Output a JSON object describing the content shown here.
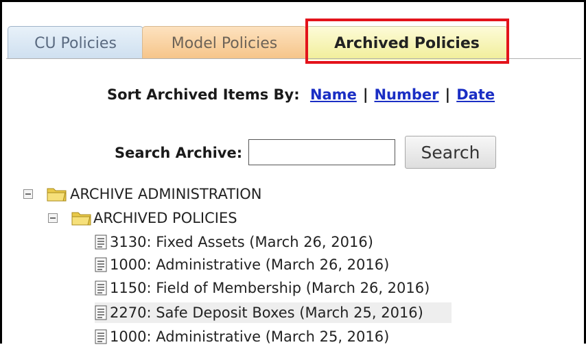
{
  "tabs": [
    {
      "label": "CU Policies"
    },
    {
      "label": "Model Policies"
    },
    {
      "label": "Archived Policies"
    }
  ],
  "sort": {
    "prefix": "Sort Archived Items By:",
    "links": [
      "Name",
      "Number",
      "Date"
    ],
    "separator": "|"
  },
  "search": {
    "label": "Search Archive:",
    "value": "",
    "button_label": "Search"
  },
  "tree": {
    "root": "ARCHIVE ADMINISTRATION",
    "folder": "ARCHIVED POLICIES",
    "items": [
      "3130: Fixed Assets (March 26, 2016)",
      "1000: Administrative (March 26, 2016)",
      "1150: Field of Membership (March 26, 2016)",
      "2270: Safe Deposit Boxes (March 25, 2016)",
      "1000: Administrative (March 25, 2016)"
    ]
  },
  "colors": {
    "highlight": "#e3131b",
    "link": "#1a2ec4",
    "active_tab": "#f1ee9a"
  }
}
